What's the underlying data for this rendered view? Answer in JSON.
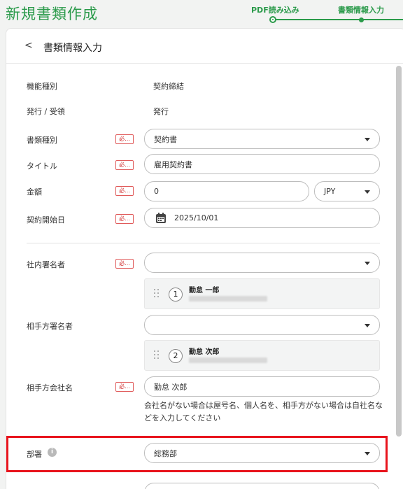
{
  "page": {
    "title": "新規書類作成"
  },
  "stepper": {
    "steps": [
      "PDF読み込み",
      "書類情報入力"
    ]
  },
  "card": {
    "back_label": "<",
    "title": "書類情報入力"
  },
  "form": {
    "function_type": {
      "label": "機能種別",
      "value": "契約締結"
    },
    "direction": {
      "label": "発行 / 受領",
      "value": "発行"
    },
    "required_label": "必...",
    "doc_type": {
      "label": "書類種別",
      "value": "契約書"
    },
    "doc_title": {
      "label": "タイトル",
      "value": "雇用契約書"
    },
    "amount": {
      "label": "金額",
      "value": "0",
      "currency": "JPY"
    },
    "start_date": {
      "label": "契約開始日",
      "value": "2025/10/01"
    },
    "internal_signer": {
      "label": "社内署名者",
      "value": "",
      "entry": {
        "index": "1",
        "name": "勤怠 一郎"
      }
    },
    "counterparty_signer": {
      "label": "相手方署名者",
      "value": "",
      "entry": {
        "index": "2",
        "name": "勤怠 次郎"
      }
    },
    "counterparty_company": {
      "label": "相手方会社名",
      "value": "勤怠 次郎",
      "hint": "会社名がない場合は屋号名、個人名を、相手方がない場合は自社名などを入力してください"
    },
    "department": {
      "label": "部署",
      "info_icon": "i",
      "value": "総務部"
    }
  },
  "colors": {
    "accent": "#2a9a4a",
    "required": "#d02a2a",
    "highlight": "#e8141d"
  },
  "icons": [
    "chevron-left-icon",
    "caret-down-icon",
    "calendar-icon",
    "drag-handle-icon",
    "info-icon"
  ]
}
